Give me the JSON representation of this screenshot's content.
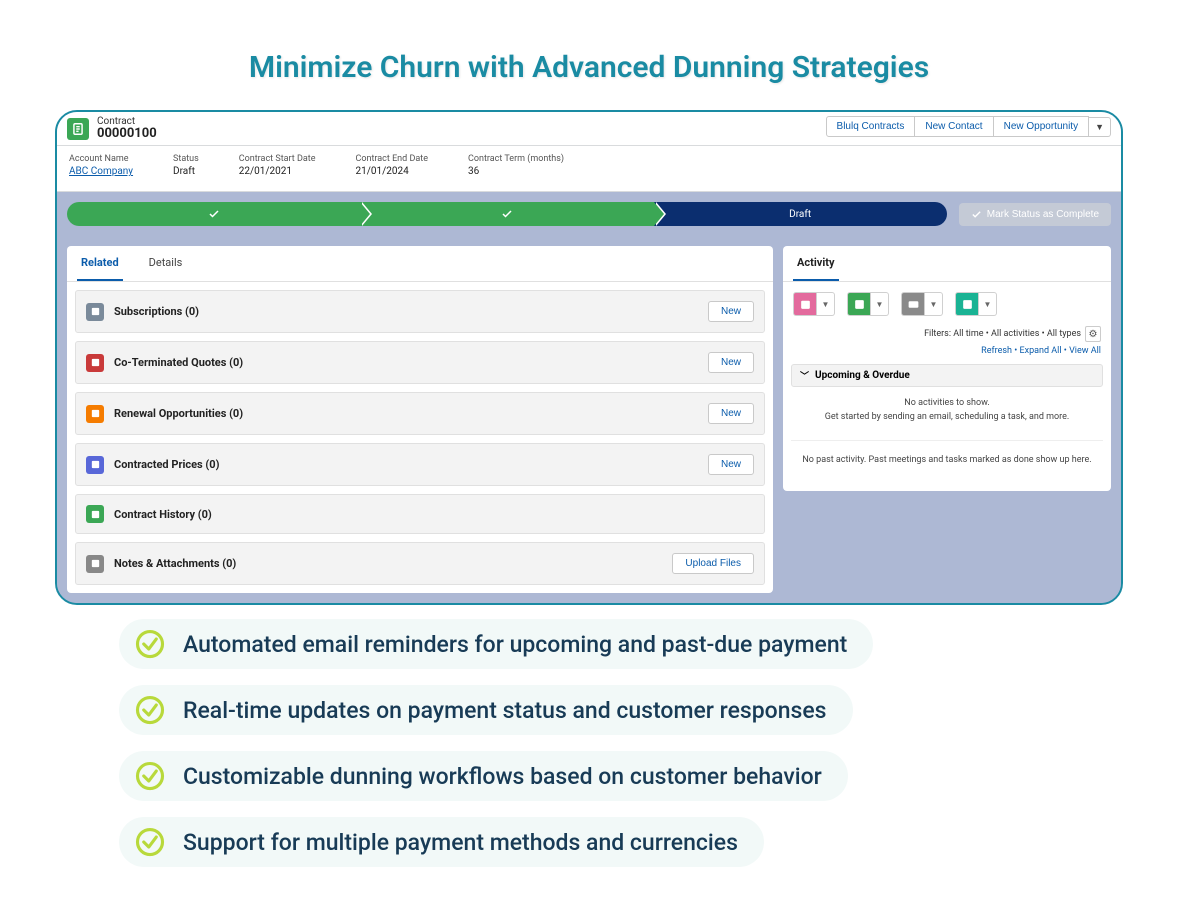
{
  "page_heading": "Minimize Churn with Advanced Dunning Strategies",
  "header": {
    "record_type": "Contract",
    "record_number": "00000100",
    "actions": {
      "btn1": "Blulq Contracts",
      "btn2": "New Contact",
      "btn3": "New Opportunity"
    }
  },
  "fields": {
    "account": {
      "label": "Account Name",
      "value": "ABC Company"
    },
    "status": {
      "label": "Status",
      "value": "Draft"
    },
    "start": {
      "label": "Contract Start Date",
      "value": "22/01/2021"
    },
    "end": {
      "label": "Contract End Date",
      "value": "21/01/2024"
    },
    "term": {
      "label": "Contract Term (months)",
      "value": "36"
    }
  },
  "path": {
    "current_label": "Draft",
    "mark_complete": "Mark Status as Complete"
  },
  "tabs": {
    "related": "Related",
    "details": "Details"
  },
  "related": [
    {
      "title": "Subscriptions (0)",
      "icon_color": "#7a8a9a",
      "icon_name": "wrench-icon",
      "button": "New"
    },
    {
      "title": "Co-Terminated Quotes (0)",
      "icon_color": "#c93a3a",
      "icon_name": "cart-icon",
      "button": "New"
    },
    {
      "title": "Renewal Opportunities (0)",
      "icon_color": "#f57c00",
      "icon_name": "opportunity-icon",
      "button": "New"
    },
    {
      "title": "Contracted Prices (0)",
      "icon_color": "#5867d8",
      "icon_name": "price-icon",
      "button": "New"
    },
    {
      "title": "Contract History (0)",
      "icon_color": "#3ba755",
      "icon_name": "history-icon",
      "button": ""
    },
    {
      "title": "Notes & Attachments (0)",
      "icon_color": "#888888",
      "icon_name": "file-icon",
      "button": "Upload Files"
    }
  ],
  "activity": {
    "tab": "Activity",
    "action_colors": {
      "log": "#e36a9d",
      "task": "#3ba755",
      "email": "#8a8a8a",
      "call": "#1ab394"
    },
    "filters_text": "Filters: All time • All activities • All types",
    "refresh": "Refresh",
    "expand": "Expand All",
    "viewall": "View All",
    "upcoming": "Upcoming & Overdue",
    "empty_line1": "No activities to show.",
    "empty_line2": "Get started by sending an email, scheduling a task, and more.",
    "past": "No past activity. Past meetings and tasks marked as done show up here."
  },
  "features": [
    "Automated email reminders for upcoming and past-due payment",
    "Real-time updates on payment status and customer responses",
    "Customizable dunning workflows based on customer behavior",
    "Support for multiple payment methods and currencies"
  ]
}
